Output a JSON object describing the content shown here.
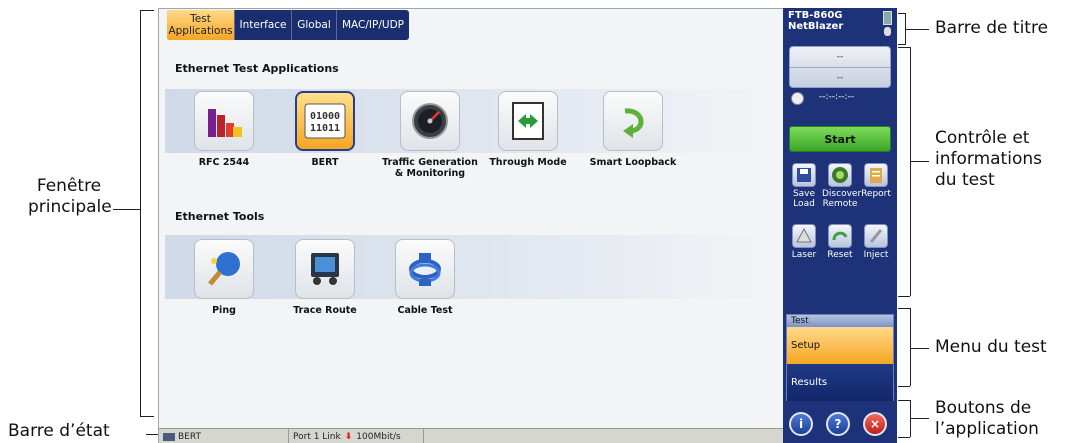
{
  "callouts": {
    "main_window_line1": "Fenêtre",
    "main_window_line2": "principale",
    "status_bar": "Barre d’état",
    "title_bar": "Barre de titre",
    "test_control_line1": "Contrôle et",
    "test_control_line2": "informations",
    "test_control_line3": "du test",
    "test_menu": "Menu du test",
    "app_buttons_line1": "Boutons de",
    "app_buttons_line2": "l’application"
  },
  "tabs": [
    {
      "line1": "Test",
      "line2": "Applications",
      "active": true
    },
    {
      "line1": "Interface"
    },
    {
      "line1": "Global"
    },
    {
      "line1": "MAC/IP/UDP"
    }
  ],
  "sections": {
    "ethernet_test_apps": "Ethernet Test Applications",
    "ethernet_tools": "Ethernet Tools"
  },
  "apps": [
    {
      "label": "RFC 2544",
      "icon": "bar-chart-icon"
    },
    {
      "label": "BERT",
      "icon": "binary-icon",
      "selected": true
    },
    {
      "label": "Traffic Generation & Monitoring",
      "icon": "gauge-icon"
    },
    {
      "label": "Through Mode",
      "icon": "arrows-icon"
    },
    {
      "label": "Smart Loopback",
      "icon": "loopback-icon"
    }
  ],
  "tools": [
    {
      "label": "Ping",
      "icon": "ping-pong-icon"
    },
    {
      "label": "Trace Route",
      "icon": "trace-route-icon"
    },
    {
      "label": "Cable Test",
      "icon": "cable-icon"
    }
  ],
  "status": {
    "test_name": "BERT",
    "port": "Port 1 Link",
    "speed": "100Mbit/s"
  },
  "side": {
    "title_line1": "FTB-860G",
    "title_line2": "NetBlazer",
    "timer_top": "--",
    "timer_bottom": "--",
    "elapsed": "--:--:--:--",
    "start": "Start",
    "tools": [
      {
        "l1": "Save",
        "l2": "Load",
        "icon": "save-icon"
      },
      {
        "l1": "Discover",
        "l2": "Remote",
        "icon": "discover-icon"
      },
      {
        "l1": "Report",
        "l2": "",
        "icon": "report-icon"
      },
      {
        "l1": "Laser",
        "l2": "",
        "icon": "laser-icon"
      },
      {
        "l1": "Reset",
        "l2": "",
        "icon": "reset-icon"
      },
      {
        "l1": "Inject",
        "l2": "",
        "icon": "inject-icon"
      }
    ],
    "menu_header": "Test",
    "menu_setup": "Setup",
    "menu_results": "Results"
  }
}
